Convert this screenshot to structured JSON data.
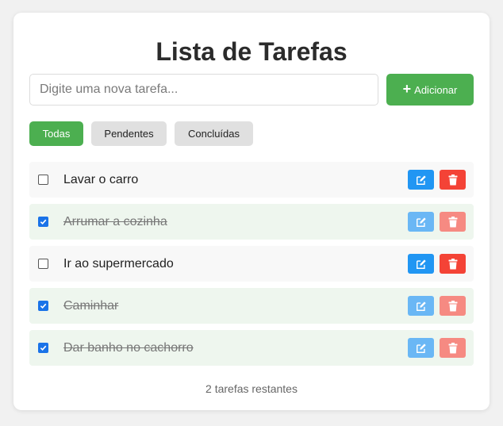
{
  "app": {
    "title": "Lista de Tarefas"
  },
  "input": {
    "placeholder": "Digite uma nova tarefa...",
    "value": ""
  },
  "add_button": {
    "icon": "+",
    "label": "Adicionar"
  },
  "filters": [
    {
      "label": "Todas",
      "active": true
    },
    {
      "label": "Pendentes",
      "active": false
    },
    {
      "label": "Concluídas",
      "active": false
    }
  ],
  "tasks": [
    {
      "text": "Lavar o carro",
      "done": false
    },
    {
      "text": "Arrumar a cozinha",
      "done": true
    },
    {
      "text": "Ir ao supermercado",
      "done": false
    },
    {
      "text": "Caminhar",
      "done": true
    },
    {
      "text": "Dar banho no cachorro",
      "done": true
    }
  ],
  "footer": {
    "remaining_text": "2 tarefas restantes"
  },
  "colors": {
    "primary_green": "#4caf50",
    "edit_blue": "#2196f3",
    "delete_red": "#f44336",
    "checkbox_blue": "#1a73e8"
  },
  "icons": {
    "edit": "edit-pencil-icon",
    "delete": "trash-icon",
    "add": "plus-icon"
  }
}
